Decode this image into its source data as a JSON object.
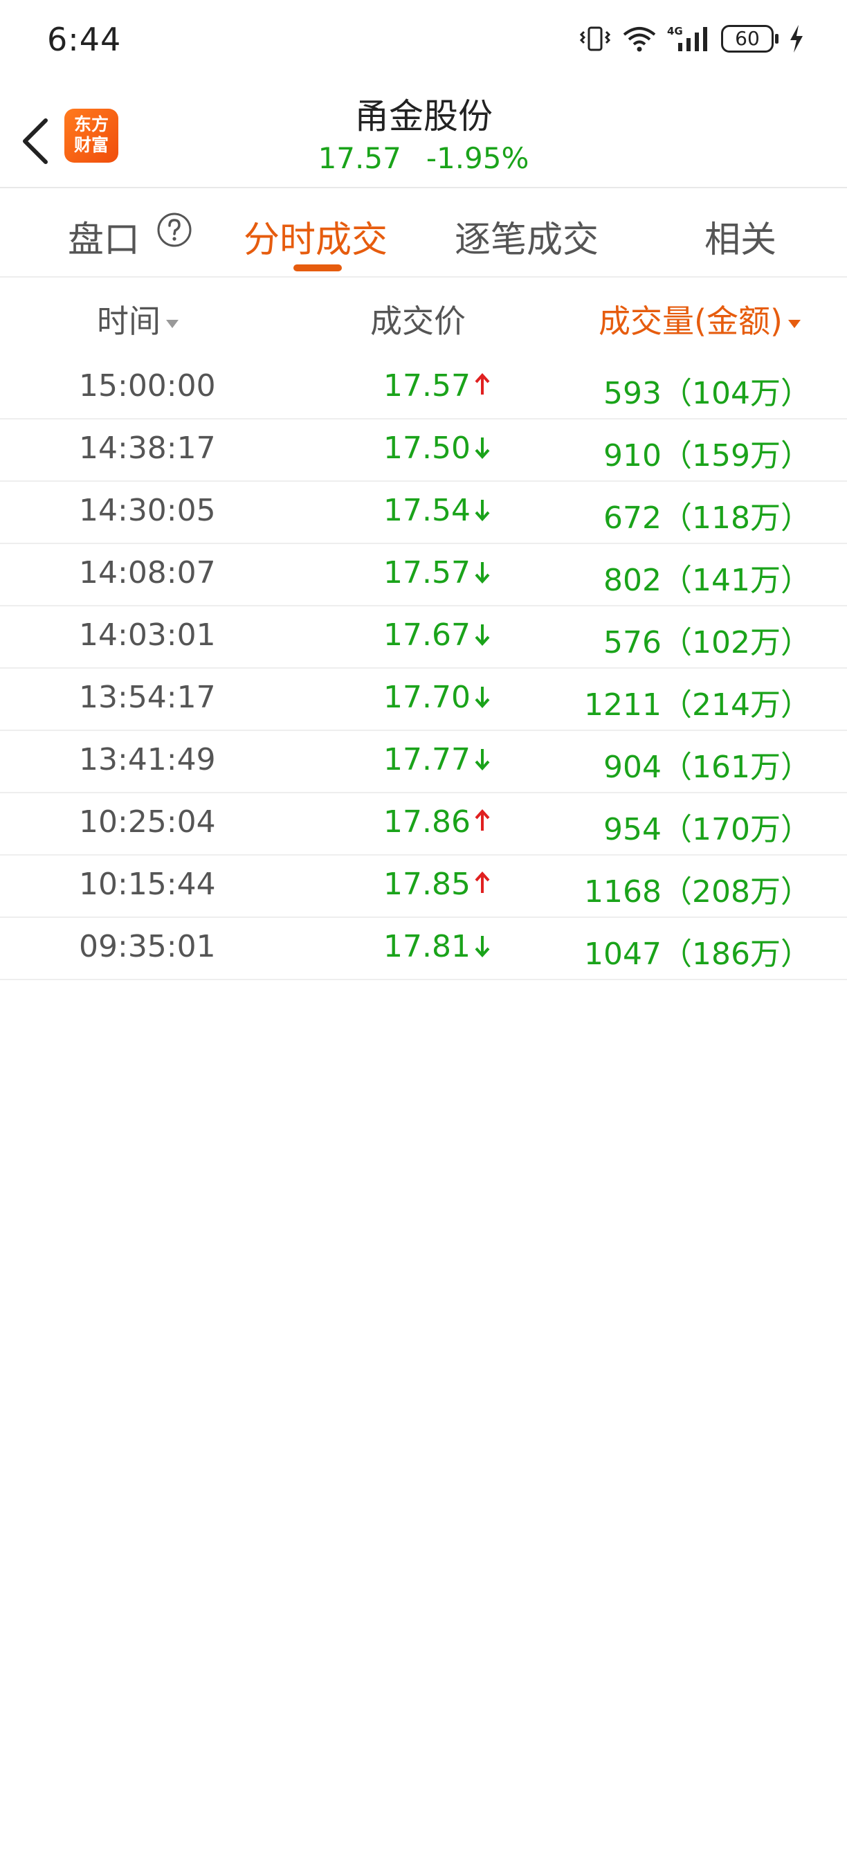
{
  "status_bar": {
    "time": "6:44",
    "network": "4G",
    "battery": "60"
  },
  "header": {
    "logo_line1": "东方",
    "logo_line2": "财富",
    "stock_name": "甬金股份",
    "price": "17.57",
    "change_pct": "-1.95%"
  },
  "tabs": [
    {
      "label": "盘口"
    },
    {
      "label": "分时成交",
      "active": true
    },
    {
      "label": "逐笔成交"
    },
    {
      "label": "相关"
    }
  ],
  "columns": {
    "time": "时间",
    "price": "成交价",
    "volume": "成交量(金额)"
  },
  "trades": [
    {
      "time": "15:00:00",
      "price": "17.57",
      "direction": "up",
      "volume": "593（104万）"
    },
    {
      "time": "14:38:17",
      "price": "17.50",
      "direction": "down",
      "volume": "910（159万）"
    },
    {
      "time": "14:30:05",
      "price": "17.54",
      "direction": "down",
      "volume": "672（118万）"
    },
    {
      "time": "14:08:07",
      "price": "17.57",
      "direction": "down",
      "volume": "802（141万）"
    },
    {
      "time": "14:03:01",
      "price": "17.67",
      "direction": "down",
      "volume": "576（102万）"
    },
    {
      "time": "13:54:17",
      "price": "17.70",
      "direction": "down",
      "volume": "1211（214万）"
    },
    {
      "time": "13:41:49",
      "price": "17.77",
      "direction": "down",
      "volume": "904（161万）"
    },
    {
      "time": "10:25:04",
      "price": "17.86",
      "direction": "up",
      "volume": "954（170万）"
    },
    {
      "time": "10:15:44",
      "price": "17.85",
      "direction": "up",
      "volume": "1168（208万）"
    },
    {
      "time": "09:35:01",
      "price": "17.81",
      "direction": "down",
      "volume": "1047（186万）"
    }
  ],
  "colors": {
    "accent": "#e65c0e",
    "down": "#1aa31a",
    "up_arrow": "#e02020"
  }
}
